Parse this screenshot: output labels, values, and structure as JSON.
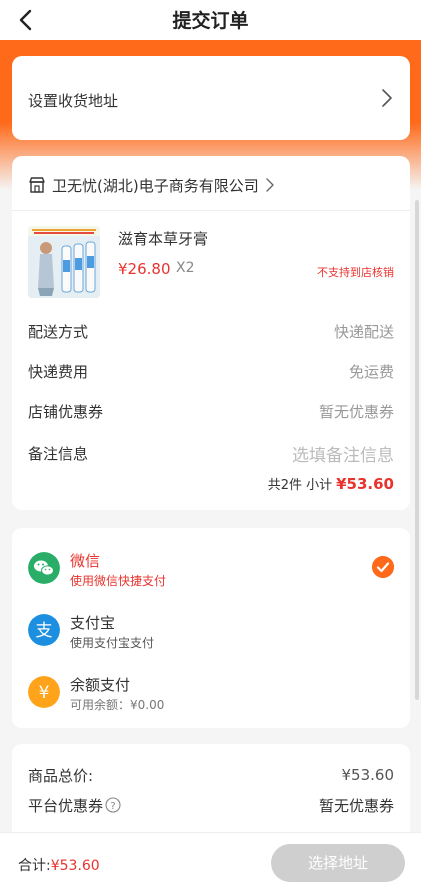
{
  "header": {
    "title": "提交订单"
  },
  "address": {
    "label": "设置收货地址"
  },
  "shop": {
    "name": "卫无忧(湖北)电子商务有限公司"
  },
  "product": {
    "name": "滋育本草牙膏",
    "price": "¥26.80",
    "qty": "X2",
    "notice": "不支持到店核销"
  },
  "order_rows": [
    {
      "key": "配送方式",
      "value": "快递配送"
    },
    {
      "key": "快递费用",
      "value": "免运费"
    },
    {
      "key": "店铺优惠券",
      "value": "暂无优惠券"
    },
    {
      "key": "备注信息",
      "placeholder": "选填备注信息"
    }
  ],
  "subtotal": {
    "label": "共2件 小计",
    "amount": "¥53.60"
  },
  "payments": [
    {
      "title": "微信",
      "sub": "使用微信快捷支付",
      "selected": true,
      "color": "#2aae67"
    },
    {
      "title": "支付宝",
      "sub": "使用支付宝支付",
      "selected": false,
      "color": "#1c8fe0"
    },
    {
      "title": "余额支付",
      "sub": "可用余额：¥0.00",
      "selected": false,
      "color": "#ffa31a"
    }
  ],
  "totals": [
    {
      "key": "商品总价:",
      "value": "¥53.60"
    },
    {
      "key": "平台优惠券",
      "value": "暂无优惠券"
    }
  ],
  "bottom": {
    "label": "合计:",
    "amount": "¥53.60",
    "button": "选择地址"
  },
  "colors": {
    "accent": "#ff6a1a",
    "price": "#e8332e"
  }
}
